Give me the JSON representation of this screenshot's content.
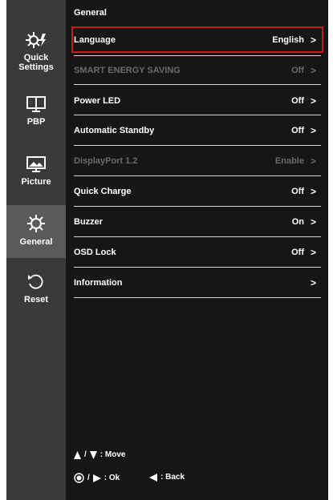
{
  "sidebar": {
    "items": [
      {
        "label": "Quick\nSettings",
        "icon": "quick-settings-icon"
      },
      {
        "label": "PBP",
        "icon": "pbp-icon"
      },
      {
        "label": "Picture",
        "icon": "picture-icon"
      },
      {
        "label": "General",
        "icon": "general-icon",
        "active": true
      },
      {
        "label": "Reset",
        "icon": "reset-icon"
      }
    ]
  },
  "menu": {
    "title": "General",
    "items": [
      {
        "label": "Language",
        "value": "English",
        "selected": true,
        "disabled": false
      },
      {
        "label": "SMART ENERGY SAVING",
        "value": "Off",
        "disabled": true
      },
      {
        "label": "Power LED",
        "value": "Off",
        "disabled": false
      },
      {
        "label": "Automatic Standby",
        "value": "Off",
        "disabled": false
      },
      {
        "label": "DisplayPort 1.2",
        "value": "Enable",
        "disabled": true
      },
      {
        "label": "Quick Charge",
        "value": "Off",
        "disabled": false
      },
      {
        "label": "Buzzer",
        "value": "On",
        "disabled": false
      },
      {
        "label": "OSD Lock",
        "value": "Off",
        "disabled": false
      },
      {
        "label": "Information",
        "value": "",
        "disabled": false
      }
    ],
    "chevron": ">"
  },
  "footer": {
    "move": ": Move",
    "ok": ": Ok",
    "back": ": Back",
    "sep": "/"
  },
  "colors": {
    "accent_border": "#d4141f",
    "disabled_text": "#6a6a6a"
  }
}
